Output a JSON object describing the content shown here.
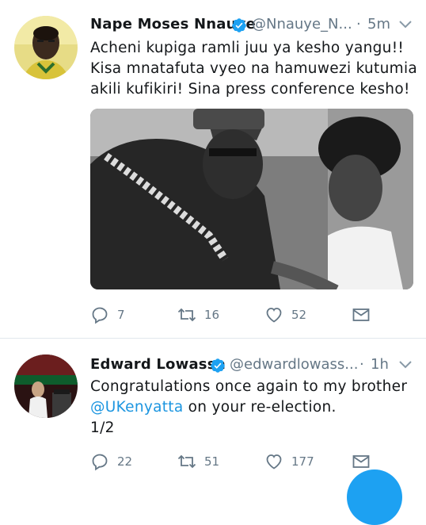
{
  "tweets": [
    {
      "name": "Nape Moses Nnauye",
      "handle": "@Nnauye_N...",
      "separator": "·",
      "time": "5m",
      "text_lines": [
        "Acheni kupiga ramli juu ya kesho yangu!!",
        "Kisa mnatafuta vyeo na hamuwezi kutumia",
        "akili kufikiri! Sina press conference kesho!"
      ],
      "reply_count": "7",
      "retweet_count": "16",
      "like_count": "52"
    },
    {
      "name": "Edward Lowassa",
      "handle": "@edwardlowass...",
      "separator": "·",
      "time": "1h",
      "text_line1": "Congratulations once again to my brother",
      "mention": "@UKenyatta",
      "text_line2_rest": " on your re-election.",
      "text_line3": "1/2",
      "reply_count": "22",
      "retweet_count": "51",
      "like_count": "177"
    }
  ],
  "colors": {
    "accent": "#1da1f2",
    "mention": "#1b95e0",
    "muted": "#657786",
    "divider": "#e1e8ed"
  }
}
